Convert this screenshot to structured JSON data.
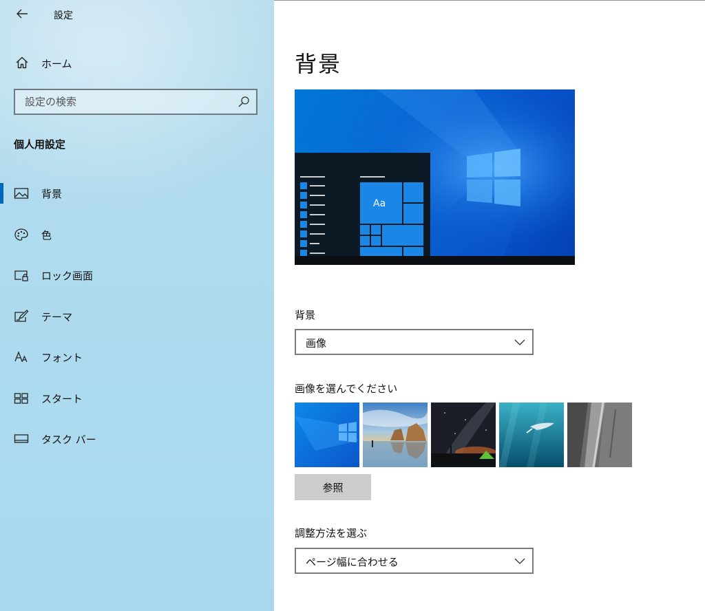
{
  "window": {
    "title": "設定"
  },
  "sidebar": {
    "home_label": "ホーム",
    "search_placeholder": "設定の検索",
    "section_heading": "個人用設定",
    "items": [
      {
        "label": "背景",
        "icon": "picture-icon",
        "active": true
      },
      {
        "label": "色",
        "icon": "palette-icon",
        "active": false
      },
      {
        "label": "ロック画面",
        "icon": "lock-screen-icon",
        "active": false
      },
      {
        "label": "テーマ",
        "icon": "theme-icon",
        "active": false
      },
      {
        "label": "フォント",
        "icon": "font-icon",
        "active": false
      },
      {
        "label": "スタート",
        "icon": "start-icon",
        "active": false
      },
      {
        "label": "タスク バー",
        "icon": "taskbar-icon",
        "active": false
      }
    ]
  },
  "main": {
    "page_title": "背景",
    "preview_tile_text": "Aa",
    "background_label": "背景",
    "background_value": "画像",
    "choose_picture_label": "画像を選んでください",
    "browse_label": "参照",
    "fit_label": "調整方法を選ぶ",
    "fit_value": "ページ幅に合わせる"
  },
  "colors": {
    "accent": "#0067c0",
    "sidebar_bg": "#afdbee",
    "preview_blue": "#0a66d3"
  }
}
